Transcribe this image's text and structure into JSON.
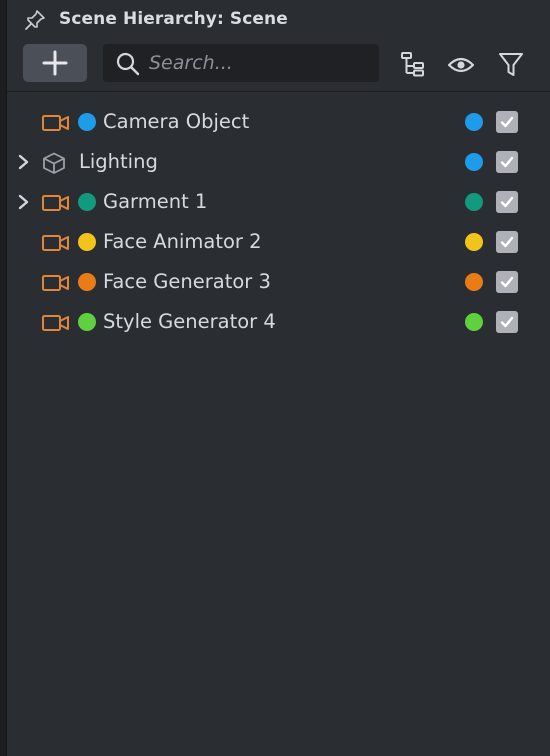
{
  "panel": {
    "title": "Scene Hierarchy: Scene"
  },
  "toolbar": {
    "add_icon": "plus-icon",
    "search": {
      "placeholder": "Search...",
      "value": ""
    },
    "tools": [
      "hierarchy-tree-icon",
      "eye-icon",
      "filter-icon"
    ]
  },
  "items": [
    {
      "label": "Camera Object",
      "icon": "camera-icon",
      "expandable": false,
      "indent": 1,
      "color": "#1e9be9",
      "checked": true
    },
    {
      "label": "Lighting",
      "icon": "cube-icon",
      "expandable": true,
      "indent": 0,
      "color": "#1e9be9",
      "checked": true
    },
    {
      "label": "Garment 1",
      "icon": "camera-icon",
      "expandable": true,
      "indent": 1,
      "color": "#119a7d",
      "checked": true
    },
    {
      "label": "Face Animator 2",
      "icon": "camera-icon",
      "expandable": false,
      "indent": 1,
      "color": "#f2c41b",
      "checked": true
    },
    {
      "label": "Face Generator 3",
      "icon": "camera-icon",
      "expandable": false,
      "indent": 1,
      "color": "#e97c15",
      "checked": true
    },
    {
      "label": "Style Generator 4",
      "icon": "camera-icon",
      "expandable": false,
      "indent": 1,
      "color": "#5fd13f",
      "checked": true
    }
  ],
  "colors": {
    "camera_icon": "#e0873a",
    "cube_icon": "#9ca1a8"
  }
}
